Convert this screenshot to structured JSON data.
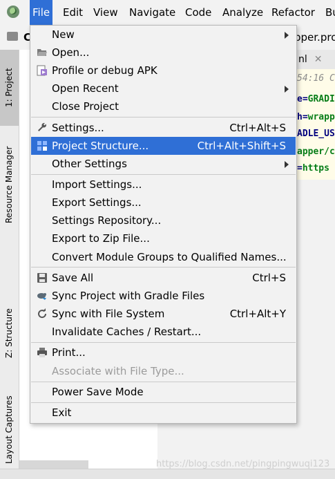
{
  "menubar": {
    "items": [
      {
        "label": "File",
        "active": true
      },
      {
        "label": "Edit"
      },
      {
        "label": "View"
      },
      {
        "label": "Navigate"
      },
      {
        "label": "Code"
      },
      {
        "label": "Analyze"
      },
      {
        "label": "Refactor"
      },
      {
        "label": "Bu"
      }
    ]
  },
  "navbar": {
    "crumb": "C",
    "filename": "pper.pro"
  },
  "editor": {
    "tab": "nl",
    "time": "54:16 C",
    "lines": [
      {
        "key": "e=",
        "val": "GRADI"
      },
      {
        "key": "h=",
        "val": "wrapp"
      },
      {
        "key": "",
        "val": "ADLE_US"
      },
      {
        "key": "",
        "val": "apper/c"
      },
      {
        "key": "=",
        "val": "https"
      }
    ]
  },
  "side_tabs": {
    "project": "1: Project",
    "resource": "Resource Manager",
    "structure": "Z: Structure",
    "captures": "Layout Captures"
  },
  "file_menu": {
    "items": [
      {
        "label": "New",
        "submenu": true,
        "icon": ""
      },
      {
        "label": "Open...",
        "icon": "folder-open-icon"
      },
      {
        "label": "Profile or debug APK",
        "icon": "apk-icon"
      },
      {
        "label": "Open Recent",
        "submenu": true
      },
      {
        "label": "Close Project"
      },
      {
        "label": "Settings...",
        "shortcut": "Ctrl+Alt+S",
        "icon": "wrench-icon"
      },
      {
        "label": "Project Structure...",
        "shortcut": "Ctrl+Alt+Shift+S",
        "icon": "project-structure-icon",
        "selected": true
      },
      {
        "label": "Other Settings",
        "submenu": true
      },
      {
        "label": "Import Settings..."
      },
      {
        "label": "Export Settings..."
      },
      {
        "label": "Settings Repository..."
      },
      {
        "label": "Export to Zip File..."
      },
      {
        "label": "Convert Module Groups to Qualified Names..."
      },
      {
        "label": "Save All",
        "shortcut": "Ctrl+S",
        "icon": "save-icon"
      },
      {
        "label": "Sync Project with Gradle Files",
        "icon": "gradle-sync-icon"
      },
      {
        "label": "Sync with File System",
        "shortcut": "Ctrl+Alt+Y",
        "icon": "refresh-icon"
      },
      {
        "label": "Invalidate Caches / Restart..."
      },
      {
        "label": "Print...",
        "icon": "printer-icon"
      },
      {
        "label": "Associate with File Type...",
        "disabled": true
      },
      {
        "label": "Power Save Mode"
      },
      {
        "label": "Exit"
      }
    ]
  },
  "watermark": "https://blog.csdn.net/pingpingwuqi123",
  "colors": {
    "selection": "#2f6fd6",
    "menu_bg": "#f2f2f2",
    "disabled_text": "#9b9b9b"
  }
}
